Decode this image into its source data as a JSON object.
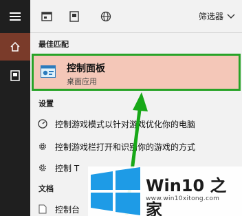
{
  "sidebar": {
    "items": [
      {
        "name": "menu",
        "icon": "hamburger-icon"
      },
      {
        "name": "home",
        "icon": "home-icon",
        "active": true
      },
      {
        "name": "documents",
        "icon": "document-icon"
      }
    ]
  },
  "topbar": {
    "icons": [
      "apps-icon",
      "document-icon",
      "globe-icon"
    ],
    "filter_label": "筛选器"
  },
  "best_match": {
    "heading": "最佳匹配",
    "title": "控制面板",
    "subtitle": "桌面应用",
    "highlight_color": "#27a327"
  },
  "settings": {
    "heading": "设置",
    "items": [
      {
        "label": "控制游戏模式以针对游戏优化你的电脑",
        "icon": "speedometer-icon"
      },
      {
        "label": "控制游戏栏打开和识别你的游戏的方式",
        "icon": "gear-icon"
      },
      {
        "label": "控制 T",
        "icon": "gear-icon"
      }
    ]
  },
  "documents": {
    "heading": "文档",
    "items": [
      {
        "label": "控制台",
        "icon": "file-icon"
      }
    ]
  },
  "watermark": {
    "brand": "Win10 之家",
    "url": "www.win10xitong.com",
    "color": "#1e9be6"
  },
  "arrow_color": "#18a818"
}
